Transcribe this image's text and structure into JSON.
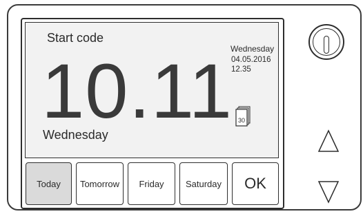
{
  "screen": {
    "label": "Start code",
    "big_time": "10.11",
    "day": "Wednesday",
    "info": {
      "day": "Wednesday",
      "date": "04.05.2016",
      "time": "12.35"
    },
    "calendar_icon_number": "30",
    "calendar_icon": "calendar-icon"
  },
  "buttons": [
    {
      "label": "Today",
      "selected": true
    },
    {
      "label": "Tomorrow",
      "selected": false
    },
    {
      "label": "Friday",
      "selected": false
    },
    {
      "label": "Saturday",
      "selected": false
    },
    {
      "label": "OK",
      "selected": false
    }
  ],
  "controls": {
    "power": "power-icon",
    "up": "triangle-up-icon",
    "down": "triangle-down-icon"
  },
  "colors": {
    "selected_button": "#dadada",
    "panel": "#f2f2f2",
    "stroke": "#2d2d2d"
  }
}
